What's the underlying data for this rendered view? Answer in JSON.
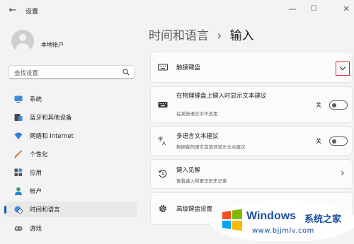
{
  "window": {
    "title": "设置",
    "back_glyph": "←",
    "min_glyph": "—",
    "max_glyph": "☐",
    "close_glyph": "✕"
  },
  "account": {
    "name": "本地帐户"
  },
  "search": {
    "placeholder": "查找设置",
    "icon": "search-icon"
  },
  "sidebar": {
    "items": [
      {
        "label": "系统",
        "icon": "monitor-icon",
        "active": false
      },
      {
        "label": "蓝牙和其他设备",
        "icon": "bluetooth-icon",
        "active": false
      },
      {
        "label": "网络和 Internet",
        "icon": "wifi-icon",
        "active": false
      },
      {
        "label": "个性化",
        "icon": "brush-icon",
        "active": false
      },
      {
        "label": "应用",
        "icon": "apps-icon",
        "active": false
      },
      {
        "label": "帐户",
        "icon": "person-icon",
        "active": false
      },
      {
        "label": "时间和语言",
        "icon": "globe-clock-icon",
        "active": true
      },
      {
        "label": "游戏",
        "icon": "gamepad-icon",
        "active": false
      }
    ]
  },
  "header": {
    "breadcrumb_parent": "时间和语言",
    "separator": "›",
    "page": "输入"
  },
  "cards": {
    "touch_keyboard": {
      "title": "触摸键盘",
      "icon": "keyboard-icon",
      "expand_glyph": "chevron-down"
    },
    "text_suggestions": {
      "title": "在物理键盘上键入时显示文本建议",
      "subtitle": "在某些语言中不适用",
      "state_label": "关",
      "icon": "keyboard-icon"
    },
    "multilingual": {
      "title": "多语言文本建议",
      "subtitle": "根据我的语言首选项显示文本建议",
      "state_label": "关",
      "icon": "language-icon"
    },
    "typing_insights": {
      "title": "键入见解",
      "subtitle": "查看键入和更正历史记录",
      "icon": "history-icon",
      "chevron": "›"
    },
    "advanced_keyboard": {
      "title": "高级键盘设置",
      "icon": "gear-icon"
    }
  },
  "watermark": {
    "brand": "Windows",
    "brand_cn": "系统之家",
    "url": "www.bjjmlv.com"
  },
  "colors": {
    "accent": "#005fb8",
    "highlight_box": "#e02020"
  }
}
